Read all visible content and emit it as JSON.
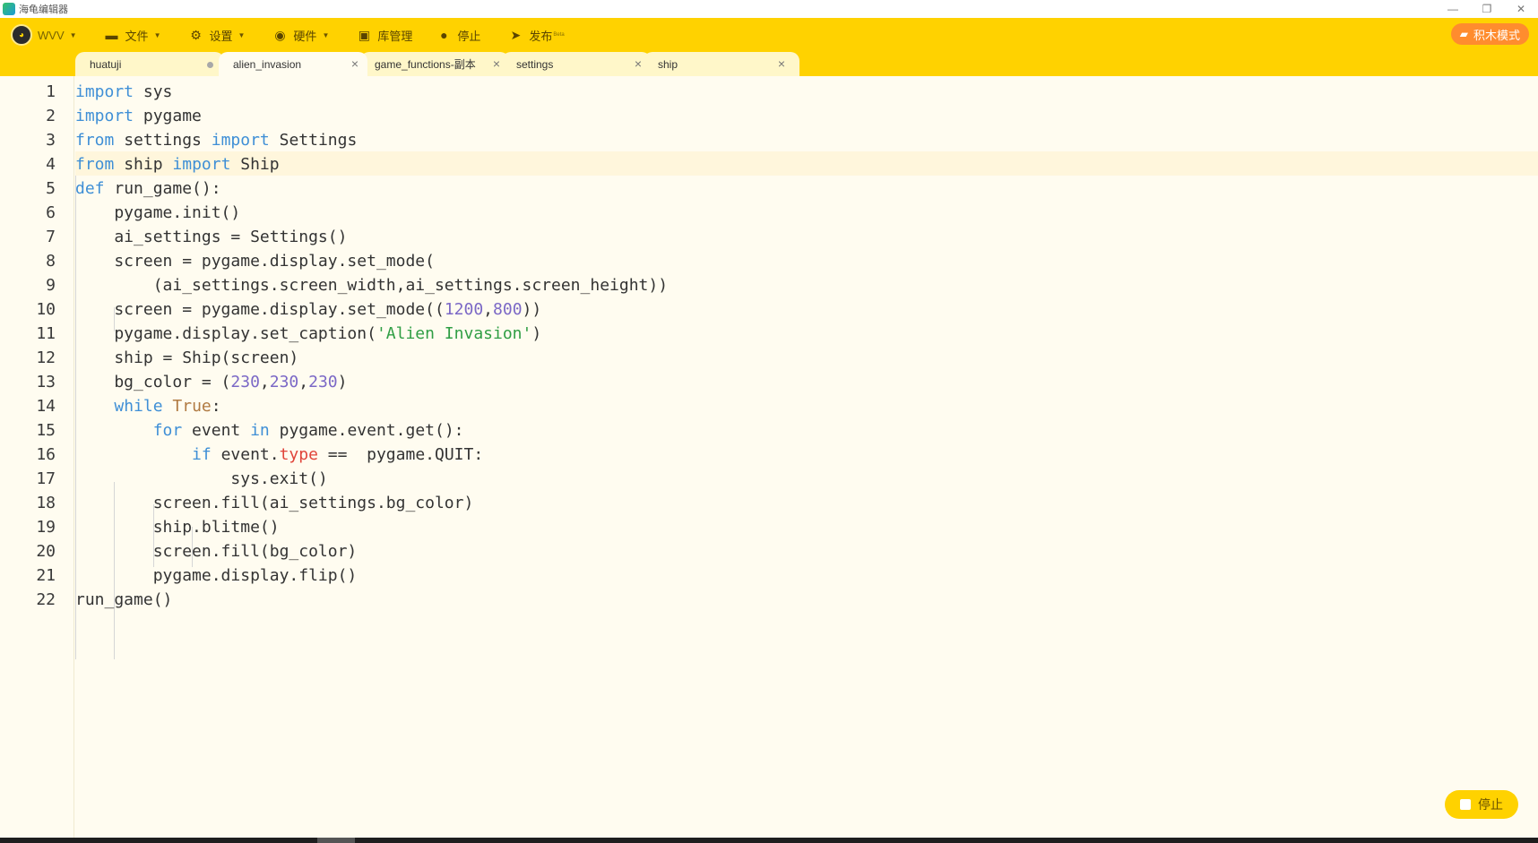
{
  "window": {
    "title": "海龟编辑器",
    "controls": [
      "—",
      "❐",
      "✕"
    ]
  },
  "toolbar": {
    "user": "WVV",
    "items": [
      {
        "label": "文件",
        "icon": "folder-icon",
        "glyph": "▬",
        "has_menu": true
      },
      {
        "label": "设置",
        "icon": "gear-icon",
        "glyph": "⚙",
        "has_menu": true
      },
      {
        "label": "硬件",
        "icon": "hardware-icon",
        "glyph": "◉",
        "has_menu": true
      },
      {
        "label": "库管理",
        "icon": "library-icon",
        "glyph": "▣",
        "has_menu": false
      },
      {
        "label": "停止",
        "icon": "stop-icon",
        "glyph": "●",
        "has_menu": false
      },
      {
        "label": "发布",
        "icon": "send-icon",
        "glyph": "➤",
        "has_menu": false
      }
    ],
    "publish_tag": "Beta",
    "block_mode_label": "积木模式",
    "accent": "#ffd200",
    "block_mode_color": "#ff8c2e"
  },
  "tabs": [
    {
      "label": "huatuji",
      "active": false,
      "unsaved": true
    },
    {
      "label": "alien_invasion",
      "active": true,
      "unsaved": false
    },
    {
      "label": "game_functions-副本",
      "active": false,
      "unsaved": false
    },
    {
      "label": "settings",
      "active": false,
      "unsaved": false
    },
    {
      "label": "ship",
      "active": false,
      "unsaved": false
    }
  ],
  "editor": {
    "current_line": 4,
    "lines": [
      "import sys",
      "import pygame",
      "from settings import Settings",
      "from ship import Ship",
      "def run_game():",
      "    pygame.init()",
      "    ai_settings = Settings()",
      "    screen = pygame.display.set_mode(",
      "        (ai_settings.screen_width,ai_settings.screen_height))",
      "    screen = pygame.display.set_mode((1200,800))",
      "    pygame.display.set_caption('Alien Invasion')",
      "    ship = Ship(screen)",
      "    bg_color = (230,230,230)",
      "    while True:",
      "        for event in pygame.event.get():",
      "            if event.type ==  pygame.QUIT:",
      "                sys.exit()",
      "        screen.fill(ai_settings.bg_color)",
      "        ship.blitme()",
      "        screen.fill(bg_color)",
      "        pygame.display.flip()",
      "run_game()"
    ]
  },
  "run": {
    "stop_label": "停止"
  }
}
